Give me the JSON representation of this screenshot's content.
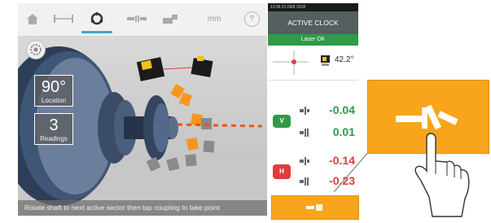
{
  "toolbar": {
    "home_icon": "home-icon",
    "unit_label": "mm",
    "help_label": "?"
  },
  "scene": {
    "location_value": "90°",
    "location_label": "Location",
    "readings_value": "3",
    "readings_label": "Readings",
    "status_text": "Rotate shaft to next active sector then tap coupling to take point"
  },
  "panel": {
    "status_time": "13:06  21 FEB 2018",
    "title": "ACTIVE CLOCK",
    "laser_status": "Laser OK",
    "angle_value": "42.2°",
    "vertical_badge": "V",
    "horizontal_badge": "H",
    "v_offset": "-0.04",
    "v_gap": "0.01",
    "h_offset": "-0.14",
    "h_gap": "-0.23",
    "colors": {
      "positive": "#2e9b48",
      "negative": "#e03c3c",
      "accent": "#f8a51d",
      "header": "#555f5f"
    }
  }
}
